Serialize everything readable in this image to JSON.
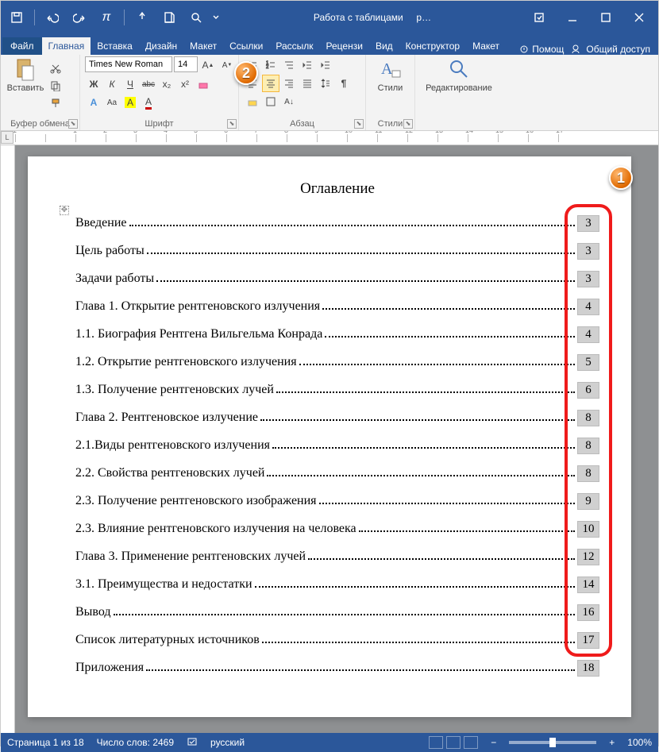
{
  "title": {
    "context": "Работа с таблицами",
    "doc": "р…"
  },
  "qat": [
    "save",
    "undo",
    "redo",
    "pi",
    "touch",
    "new",
    "preview"
  ],
  "tabs": {
    "file": "Файл",
    "items": [
      "Главная",
      "Вставка",
      "Дизайн",
      "Макет",
      "Ссылки",
      "Рассылк",
      "Рецензи",
      "Вид"
    ],
    "context_items": [
      "Конструктор",
      "Макет"
    ],
    "active": "Главная",
    "help": "Помощ",
    "share": "Общий доступ"
  },
  "ribbon": {
    "clipboard": {
      "paste": "Вставить",
      "label": "Буфер обмена"
    },
    "font": {
      "name": "Times New Roman",
      "size": "14",
      "label": "Шрифт",
      "bold": "Ж",
      "italic": "К",
      "underline": "Ч",
      "strike": "abc",
      "sub": "x₂",
      "sup": "x²"
    },
    "paragraph": {
      "label": "Абзац"
    },
    "styles": {
      "btn": "Стили",
      "label": "Стили"
    },
    "editing": {
      "btn": "Редактирование"
    }
  },
  "callouts": {
    "c1": "1",
    "c2": "2"
  },
  "document": {
    "title": "Оглавление",
    "toc": [
      {
        "text": "Введение",
        "page": "3"
      },
      {
        "text": " Цель работы",
        "page": "3"
      },
      {
        "text": "Задачи работы",
        "page": "3"
      },
      {
        "text": "Глава 1. Открытие рентгеновского излучения",
        "page": "4"
      },
      {
        "text": "1.1. Биография Рентгена Вильгельма Конрада",
        "page": "4"
      },
      {
        "text": "1.2. Открытие рентгеновского излучения ",
        "page": "5"
      },
      {
        "text": "1.3. Получение рентгеновских лучей",
        "page": "6"
      },
      {
        "text": "Глава 2. Рентгеновское излучение",
        "page": "8"
      },
      {
        "text": "2.1.Виды рентгеновского излучения",
        "page": "8"
      },
      {
        "text": "2.2. Свойства рентгеновских лучей",
        "page": "8"
      },
      {
        "text": "2.3. Получение рентгеновского изображения",
        "page": "9"
      },
      {
        "text": "2.3. Влияние рентгеновского излучения на человека",
        "page": "10"
      },
      {
        "text": "Глава 3. Применение рентгеновских лучей",
        "page": "12"
      },
      {
        "text": "3.1. Преимущества и недостатки",
        "page": "14"
      },
      {
        "text": "Вывод",
        "page": "16"
      },
      {
        "text": "Список литературных источников",
        "page": "17"
      },
      {
        "text": "Приложения",
        "page": "18"
      }
    ]
  },
  "status": {
    "page": "Страница 1 из 18",
    "words": "Число слов: 2469",
    "lang": "русский",
    "zoom": "100%",
    "minus": "−",
    "plus": "+"
  }
}
